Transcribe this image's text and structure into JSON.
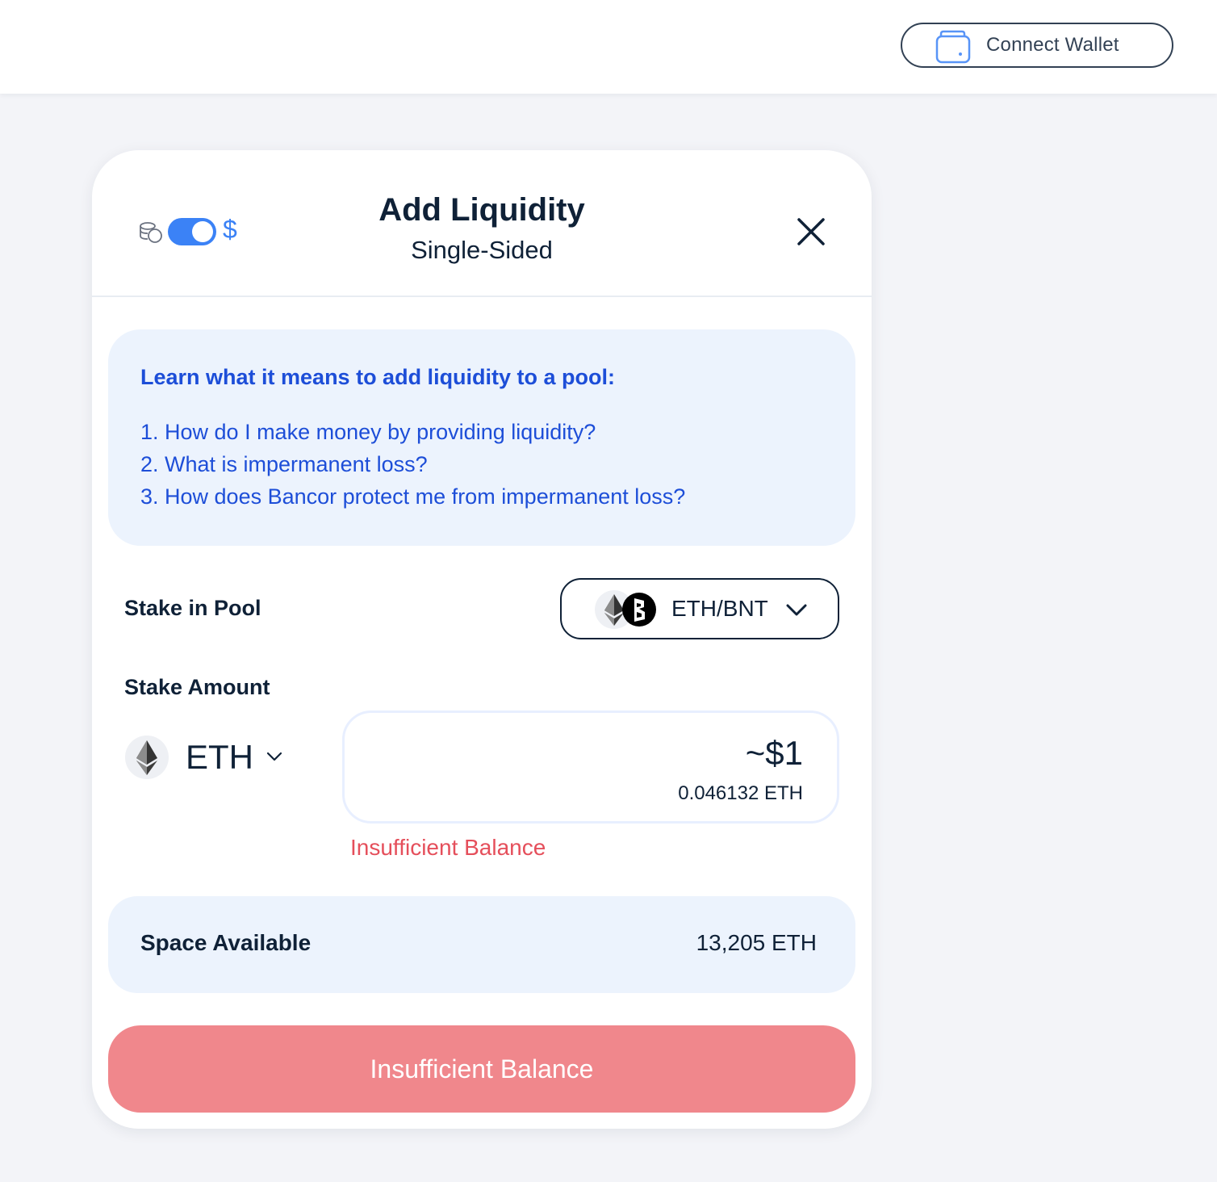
{
  "header": {
    "connect_wallet_label": "Connect Wallet"
  },
  "modal": {
    "title": "Add Liquidity",
    "subtitle": "Single-Sided",
    "toggle": {
      "currency_symbol": "$",
      "state": "on"
    },
    "learn": {
      "title": "Learn what it means to add liquidity to a pool:",
      "links": [
        "1. How do I make money by providing liquidity?",
        "2. What is impermanent loss?",
        "3. How does Bancor protect me from impermanent loss?"
      ]
    },
    "stake_in_pool": {
      "label": "Stake in Pool",
      "selected_pool": "ETH/BNT"
    },
    "stake_amount": {
      "label": "Stake Amount",
      "token": "ETH",
      "usd_value": "~$1",
      "token_value": "0.046132 ETH",
      "error": "Insufficient Balance"
    },
    "space_available": {
      "label": "Space Available",
      "value": "13,205 ETH"
    },
    "submit_label": "Insufficient Balance"
  },
  "colors": {
    "accent": "#3b82f6",
    "link": "#1d4ed8",
    "error": "#e54f5b",
    "disabled_button": "#f0878c",
    "info_background": "#ecf3fd",
    "text": "#0f2137"
  },
  "icons": [
    "wallet-icon",
    "coins-icon",
    "close-icon",
    "eth-logo-icon",
    "bnt-logo-icon",
    "chevron-down-icon"
  ]
}
